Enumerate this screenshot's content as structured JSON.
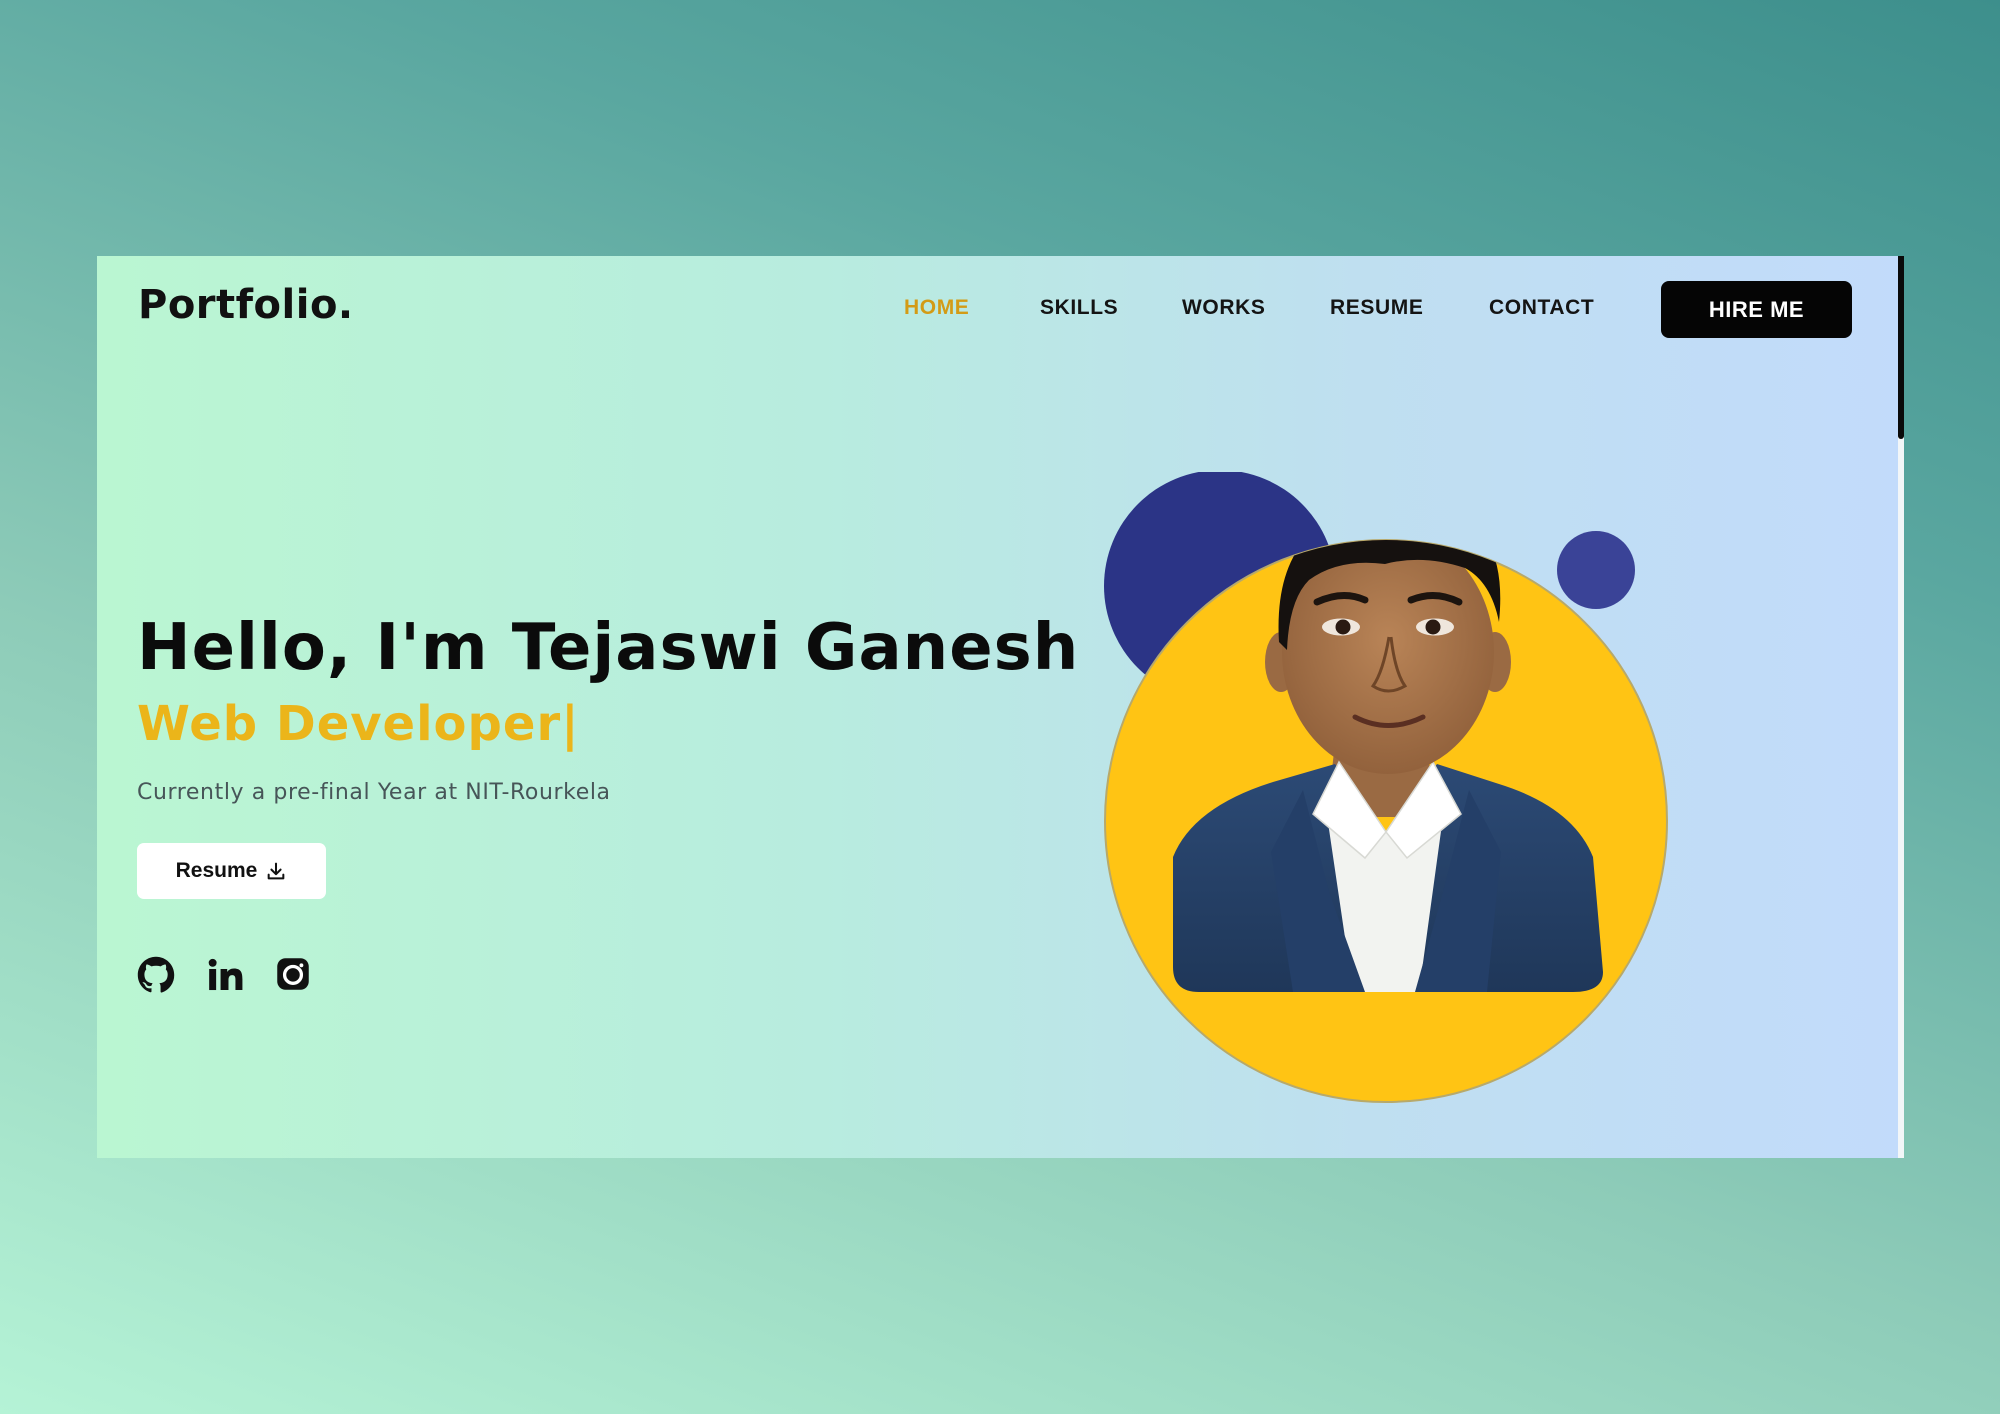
{
  "brand": {
    "logo": "Portfolio."
  },
  "nav": {
    "items": [
      {
        "label": "HOME",
        "active": true
      },
      {
        "label": "SKILLS",
        "active": false
      },
      {
        "label": "WORKS",
        "active": false
      },
      {
        "label": "RESUME",
        "active": false
      },
      {
        "label": "CONTACT",
        "active": false
      }
    ],
    "cta_label": "HIRE ME"
  },
  "hero": {
    "title": "Hello, I'm Tejaswi Ganesh",
    "role": "Web Developer|",
    "subtitle": "Currently a pre-final Year at NIT-Rourkela",
    "resume_label": "Resume",
    "resume_icon": "download-icon"
  },
  "socials": [
    {
      "icon": "github-icon"
    },
    {
      "icon": "linkedin-icon"
    },
    {
      "icon": "instagram-icon"
    }
  ],
  "colors": {
    "accent": "#ebb51a",
    "nav_active": "#d39b16",
    "dark": "#050505",
    "circle_yellow": "#ffc414",
    "circle_navy": "#2b3486"
  }
}
